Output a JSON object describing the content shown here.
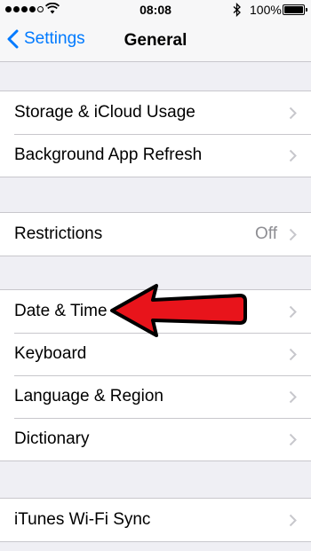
{
  "status_bar": {
    "time": "08:08",
    "battery": "100%",
    "signal_icon": "signal-dots-icon",
    "wifi_icon": "wifi-icon",
    "bluetooth_icon": "bluetooth-icon",
    "battery_icon": "battery-icon",
    "battery_level": 1.0
  },
  "nav": {
    "back_label": "Settings",
    "title": "General"
  },
  "groups": [
    {
      "rows": [
        {
          "label": "Storage & iCloud Usage"
        },
        {
          "label": "Background App Refresh"
        }
      ]
    },
    {
      "rows": [
        {
          "label": "Restrictions",
          "value": "Off"
        }
      ]
    },
    {
      "rows": [
        {
          "label": "Date & Time"
        },
        {
          "label": "Keyboard"
        },
        {
          "label": "Language & Region"
        },
        {
          "label": "Dictionary"
        }
      ]
    },
    {
      "rows": [
        {
          "label": "iTunes Wi-Fi Sync"
        }
      ]
    }
  ],
  "annotation": {
    "arrow_color": "#e8141b",
    "arrow_icon": "red-arrow-icon"
  },
  "colors": {
    "accent": "#007aff",
    "background": "#efeff4",
    "separator": "#c8c7cc",
    "secondary_text": "#8e8e93"
  }
}
